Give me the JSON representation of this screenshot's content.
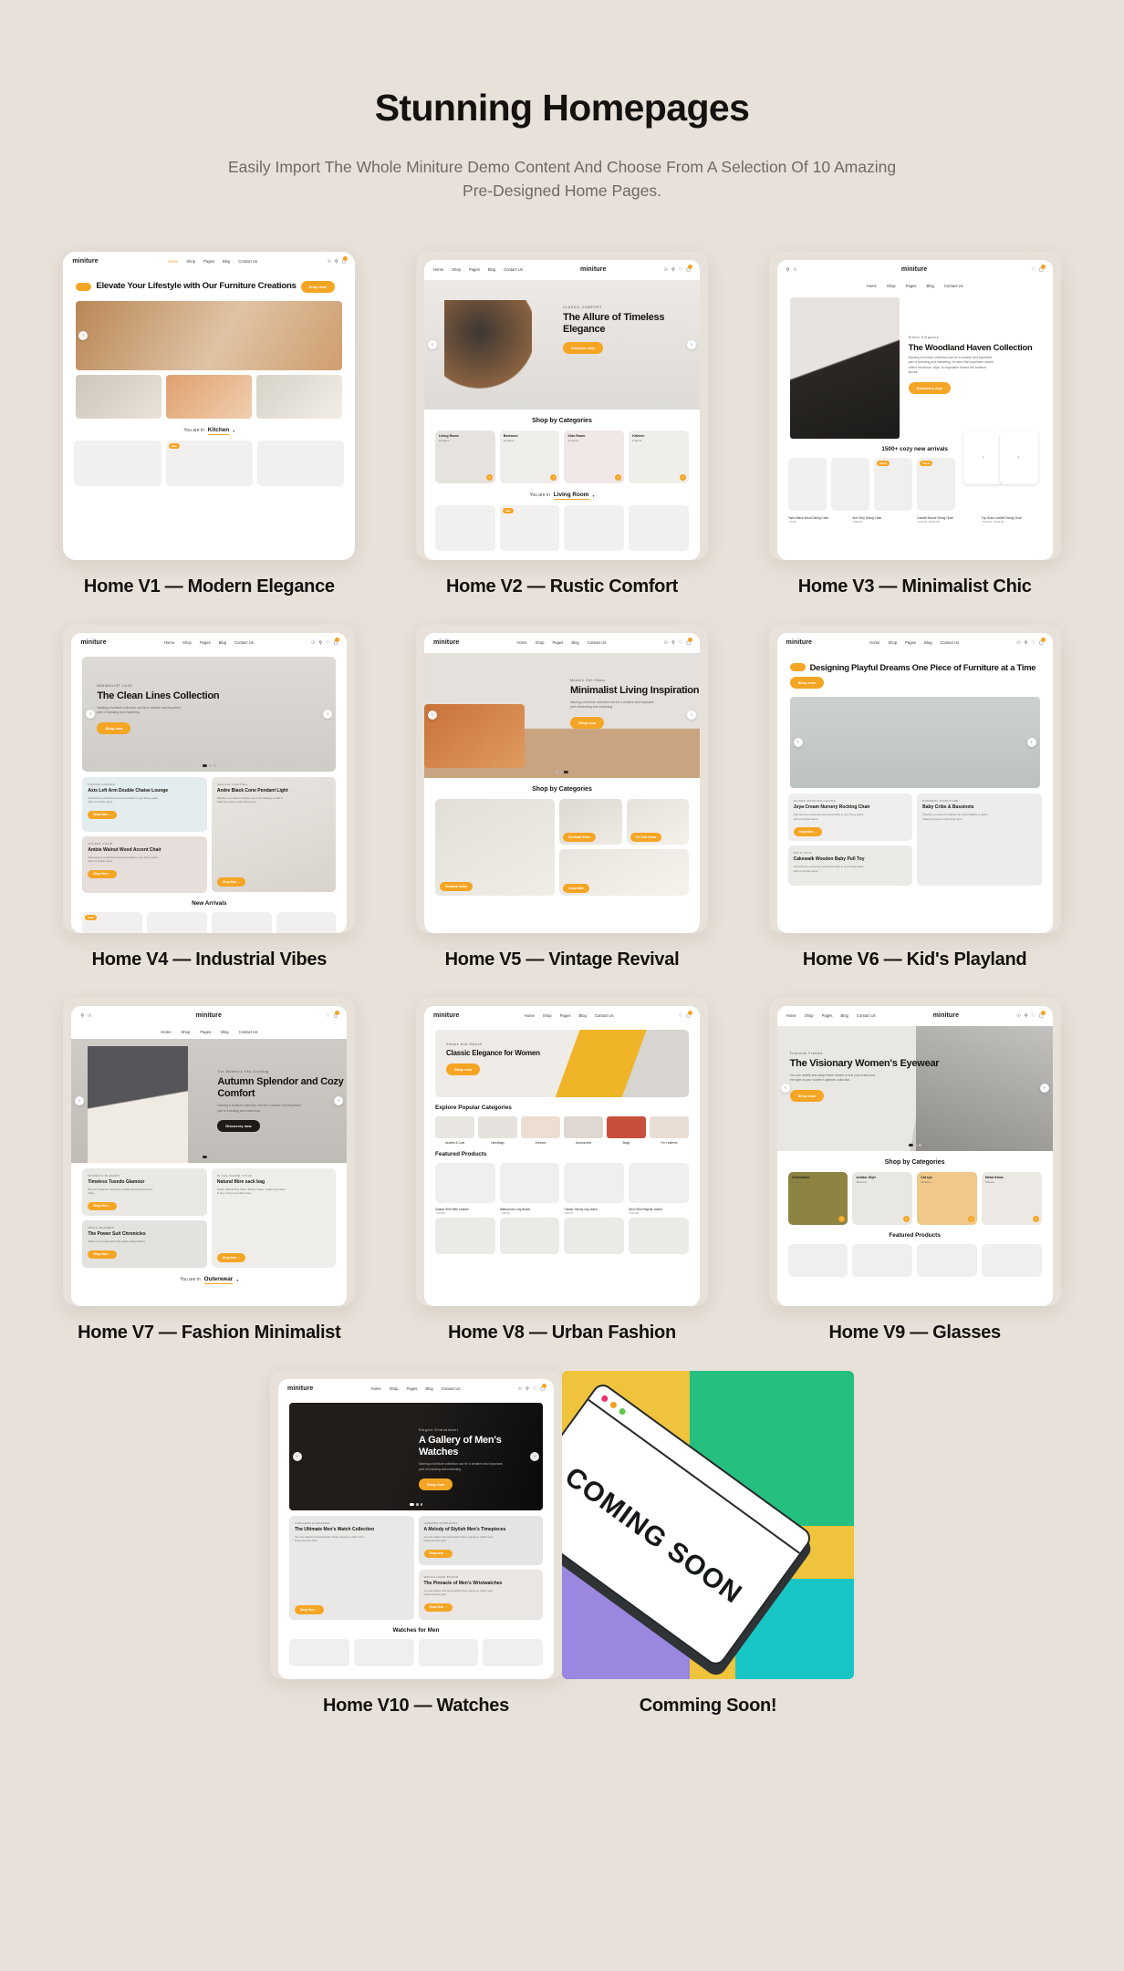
{
  "header": {
    "title": "Stunning Homepages",
    "subtitle": "Easily Import The Whole Miniture Demo Content And Choose From A Selection Of 10 Amazing Pre-Designed Home Pages."
  },
  "brand": {
    "logo": "miniture",
    "accent": "#f5a524"
  },
  "nav": {
    "items": [
      "Home",
      "Shop",
      "Pages",
      "Blog",
      "Contact Us"
    ],
    "icons": [
      "user-icon",
      "search-icon",
      "wishlist-icon",
      "cart-icon"
    ]
  },
  "cards": [
    {
      "caption": "Home V1 — Modern Elegance",
      "hero_title": "Elevate Your Lifestyle with Our Furniture Creations",
      "hero_button": "Shop now",
      "footer_label": "You are in",
      "footer_value": "Kitchen"
    },
    {
      "caption": "Home V2 — Rustic Comfort",
      "eyebrow": "CLASSIC COMFORT",
      "hero_title": "The Allure of Timeless Elegance",
      "hero_button": "Discover now",
      "section_title": "Shop by Categories",
      "categories": [
        {
          "name": "Living Room",
          "count": "12 Items"
        },
        {
          "name": "Bedroom",
          "count": "10 Items"
        },
        {
          "name": "Kids Room",
          "count": "14 Items"
        },
        {
          "name": "Kitchen",
          "count": "8 Items"
        }
      ],
      "footer_label": "You are in",
      "footer_value": "Living Room",
      "product_badge": "Sale"
    },
    {
      "caption": "Home V3 — Minimalist Chic",
      "eyebrow": "Rustic Elegance",
      "hero_title": "The Woodland Haven Collection",
      "hero_desc": "Naming a furniture collection can be a creative and important part of branding and marketing. An idea that expresses should reflect the theme, style, or inspiration behind the furniture pieces.",
      "hero_button": "Discovery now",
      "section_title": "1500+ cozy new arrivals",
      "products": [
        {
          "name": "Paolo Black Wood Dining Chair",
          "price": "$20.00"
        },
        {
          "name": "Ana Grey Dining Chair",
          "price": "$409.00"
        },
        {
          "name": "Camelli Boucle Dining Chair",
          "price": "$444.00 - $529.00",
          "badge": "SALE"
        },
        {
          "name": "Top Grain Leather Dining Chair",
          "price": "$528.00 - $679.00",
          "badge": "SALE"
        }
      ]
    },
    {
      "caption": "Home V4 — Industrial Vibes",
      "eyebrow": "MINIMALIST LUXE",
      "hero_title": "The Clean Lines Collection",
      "hero_desc": "Naming a furniture collection can be a creative and important part of branding and marketing.",
      "hero_button": "Shop now",
      "promos": [
        {
          "kicker": "CHAISE LOUNGE",
          "title": "Axis Left Arm Double Chaise Lounge",
          "desc": "Add sensory excitement and personality to your living space with our Ambie decor.",
          "button": "Shop Now →"
        },
        {
          "kicker": "CEILING LIGHTING",
          "title": "Andre Black Cone Pendant Light",
          "desc": "Whether you want to brighten up a dim hallway or add a statement piece to the living room.",
          "button": "Shop Now →"
        },
        {
          "kicker": "ACCENT CHAIR",
          "title": "Ambie Walnut Wood Accent Chair",
          "desc": "Add sensory excitement and personality to your living space with our Ambie decor.",
          "button": "Shop Now →"
        }
      ],
      "section_title": "New Arrivals"
    },
    {
      "caption": "Home V5 — Vintage Revival",
      "eyebrow": "Modern Zen Oasis",
      "hero_title": "Minimalist Living Inspiration",
      "hero_desc": "Naming a furniture collection can be a creative and important part of branding and marketing.",
      "hero_button": "Shop now",
      "section_title": "Shop by Categories",
      "category_tags": [
        "Sectional Sofas",
        "For Kids Room",
        "Lamp table"
      ]
    },
    {
      "caption": "Home V6 — Kid's Playland",
      "hero_title": "Designing Playful Dreams One Piece of Furniture at a Time",
      "hero_button": "Shop now",
      "promos": [
        {
          "kicker": "GLIDER ROCKING CHAIRS",
          "title": "Joya Cream Nursery Rocking Chair",
          "desc": "Add sensory excitement and personality to your living space with our Ambie decor.",
          "button": "Shop Now →"
        },
        {
          "kicker": "NURSERY FURNITURE",
          "title": "Baby Cribs & Bassinets",
          "desc": "Whether you want to brighten up a dim hallway or add a statement piece to the living room.",
          "button": "Shop Now →"
        },
        {
          "kicker": "KID'S TOYS",
          "title": "Cakewalk Wooden Baby Pull Toy",
          "desc": "Add sensory excitement and personality to your living space with our Ambie decor.",
          "button": "Shop Now →"
        }
      ]
    },
    {
      "caption": "Home V7 — Fashion Minimalist",
      "eyebrow": "Our Women's Fall Clothing",
      "hero_title": "Autumn Splendor and Cozy Comfort",
      "hero_desc": "Naming a furniture collection can be a creative and important part of branding and marketing.",
      "hero_button": "Discovery now",
      "promos": [
        {
          "kicker": "WOMEN'S BLAZERS",
          "title": "Timeless Tuxedo Glamour",
          "desc": "Beyond Collection. Premium quality. Recycled wool mix fabric.",
          "button": "Shop Now →"
        },
        {
          "kicker": "IN THE SHADE STYLE",
          "title": "Natural fibre sack bag",
          "desc": "Small. Natural fibre fabric. Bucket shape. Inside bag. Silver D-ring. Long removable strap.",
          "button": "Shop Now →"
        },
        {
          "kicker": "MEN'S BLAZERS",
          "title": "The Power Suit Chronicles",
          "desc": "Tailored suit made with high quality Italian fabrics.",
          "button": "Shop Now →"
        }
      ],
      "footer_label": "You are in",
      "footer_value": "Outerwear"
    },
    {
      "caption": "Home V8 — Urban Fashion",
      "eyebrow": "Simple And Stylish",
      "hero_title": "Classic Elegance for Women",
      "hero_button": "Shop now",
      "section_title": "Explore Popular Categories",
      "categories": [
        {
          "name": "Jackets & Coat"
        },
        {
          "name": "Handbags"
        },
        {
          "name": "Dresses"
        },
        {
          "name": "Accessories"
        },
        {
          "name": "Bags"
        },
        {
          "name": "For Leathers"
        }
      ],
      "section_title2": "Featured Products",
      "products": [
        {
          "name": "Classic Shirt With Leather",
          "price": "$120.00"
        },
        {
          "name": "Waterproof Long Blazer",
          "price": "$145.00"
        },
        {
          "name": "Classic Skinny Leg Jeans",
          "price": "$99.00"
        },
        {
          "name": "Wool Slim Regular Jacket",
          "price": "$210.00"
        }
      ]
    },
    {
      "caption": "Home V9 — Glasses",
      "eyebrow": "Feminine Frames",
      "hero_title": "The Visionary Women's Eyewear",
      "hero_desc": "You can modify and adapt these names to suit your brand and the style of your women's glasses collection.",
      "hero_button": "Shop now",
      "section_title": "Shop by Categories",
      "categories": [
        {
          "name": "Clubmaster",
          "count": "12 Items"
        },
        {
          "name": "Aviator Style",
          "count": "10 Items"
        },
        {
          "name": "Cat eye",
          "count": "44 Items"
        },
        {
          "name": "Metal frame",
          "count": "8 Items"
        }
      ],
      "section_title2": "Featured Products"
    },
    {
      "caption": "Home V10 — Watches",
      "eyebrow": "Elegant Embodiment",
      "hero_title": "A Gallery of Men's Watches",
      "hero_desc": "Naming a furniture collection can be a creative and important part of branding and marketing.",
      "hero_button": "Shop now",
      "promos": [
        {
          "kicker": "TIMELESS ELEGANCE",
          "title": "The Ultimate Men's Watch Collection",
          "desc": "You can adjust and personalize these names to match your brand and the style.",
          "button": "Shop Now →"
        },
        {
          "kicker": "CHRONO SYMPHONY",
          "title": "A Melody of Stylish Men's Timepieces",
          "desc": "You can adjust and personalize these names to match your brand and the style.",
          "button": "Shop Now →"
        },
        {
          "kicker": "WATCH HAND BOUND",
          "title": "The Pinnacle of Men's Wristwatches",
          "desc": "You can adjust and personalize these names to match your brand and the style.",
          "button": "Shop Now →"
        }
      ],
      "section_title": "Watches for Men"
    },
    {
      "caption": "Comming Soon!",
      "coming_soon_text": "COMING SOON"
    }
  ]
}
